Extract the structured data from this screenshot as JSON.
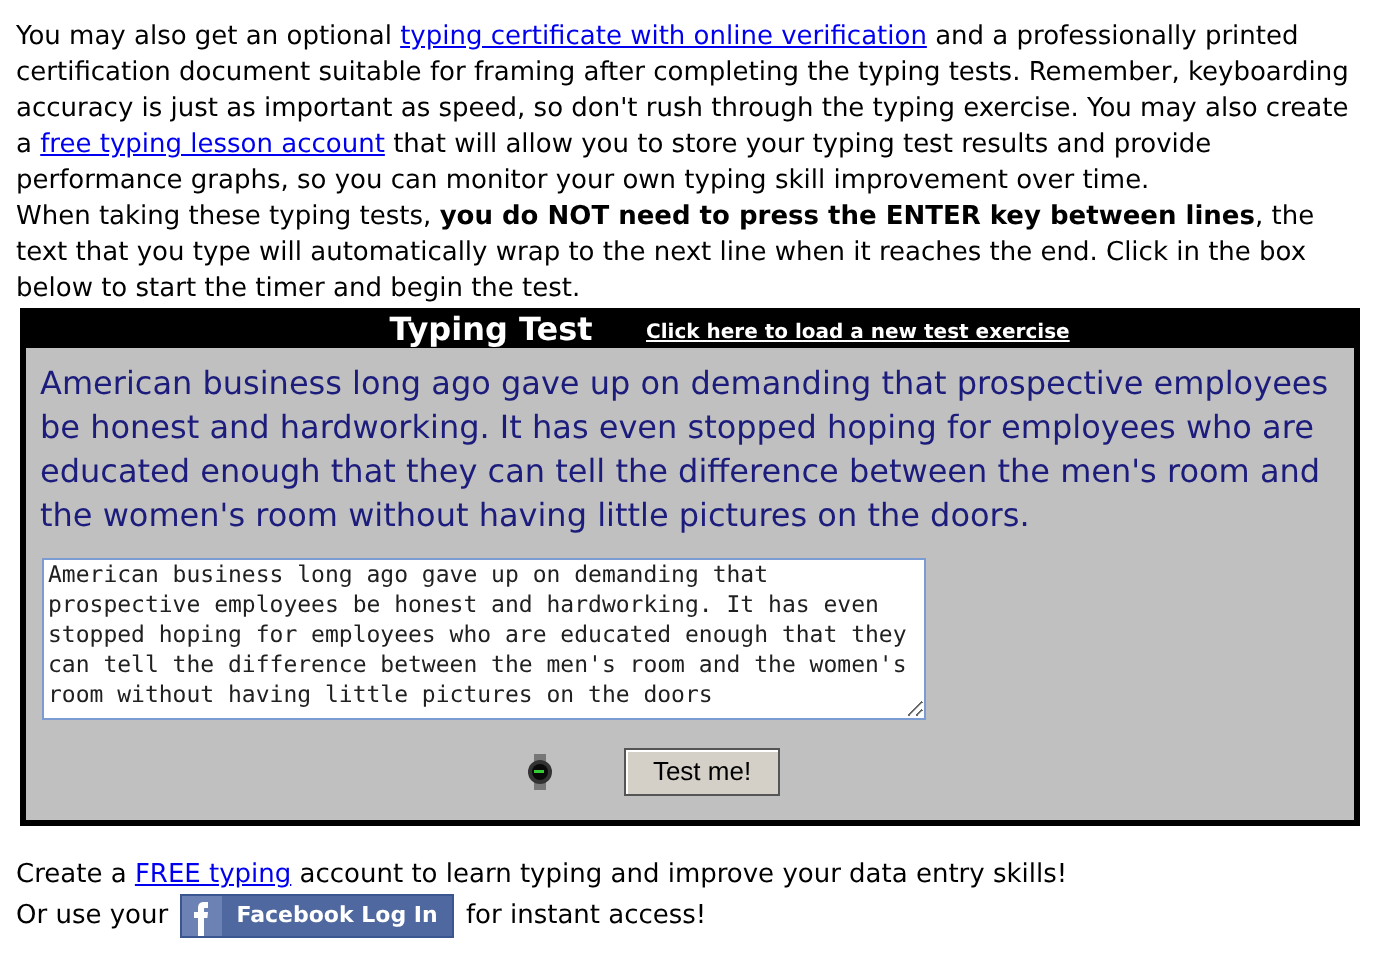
{
  "intro": [
    {
      "segments": [
        {
          "kind": "text",
          "text": "You may also get an optional "
        },
        {
          "kind": "link",
          "text": "typing certificate with online verification"
        },
        {
          "kind": "text",
          "text": " and a professionally printed certification document suitable for framing after completing the typing tests. Remember, keyboarding accuracy is just as important as speed, so don't rush through the typing exercise. You may also create a "
        },
        {
          "kind": "link",
          "text": "free typing lesson account"
        },
        {
          "kind": "text",
          "text": " that will allow you to store your typing test results and provide performance graphs, so you can monitor your own typing skill improvement over time."
        }
      ]
    },
    {
      "segments": [
        {
          "kind": "text",
          "text": "When taking these typing tests, **you do NOT need to press the ENTER key between lines**, the text that you type will automatically wrap to the next line when it reaches the end. Click in the box below to start the timer and begin the test."
        }
      ]
    }
  ],
  "test": {
    "title": "Typing Test",
    "new_exercise_link": "Click here to load a new test exercise",
    "passage": "American business long ago gave up on demanding that prospective employees be honest and hardworking. It has even stopped hoping for employees who are educated enough that they can tell the difference between the men's room and the women's room without having little pictures on the doors.",
    "typed": "American business long ago gave up on demanding that prospective employees be honest and hardworking. It has even stopped hoping for employees who are educated enough that they can tell the difference between the men's room and the women's room without having little pictures on the doors",
    "button": "Test me!"
  },
  "footer": [
    {
      "segments": [
        {
          "kind": "text",
          "text": "Create a "
        },
        {
          "kind": "link",
          "text": "FREE typing"
        },
        {
          "kind": "text",
          "text": " account to learn typing and improve your data entry skills!"
        }
      ]
    },
    {
      "segments": [
        {
          "kind": "text",
          "text": "Or use your "
        },
        {
          "kind": "facebook",
          "text": "Facebook Log In"
        },
        {
          "kind": "text",
          "text": " for instant access!"
        }
      ]
    }
  ]
}
